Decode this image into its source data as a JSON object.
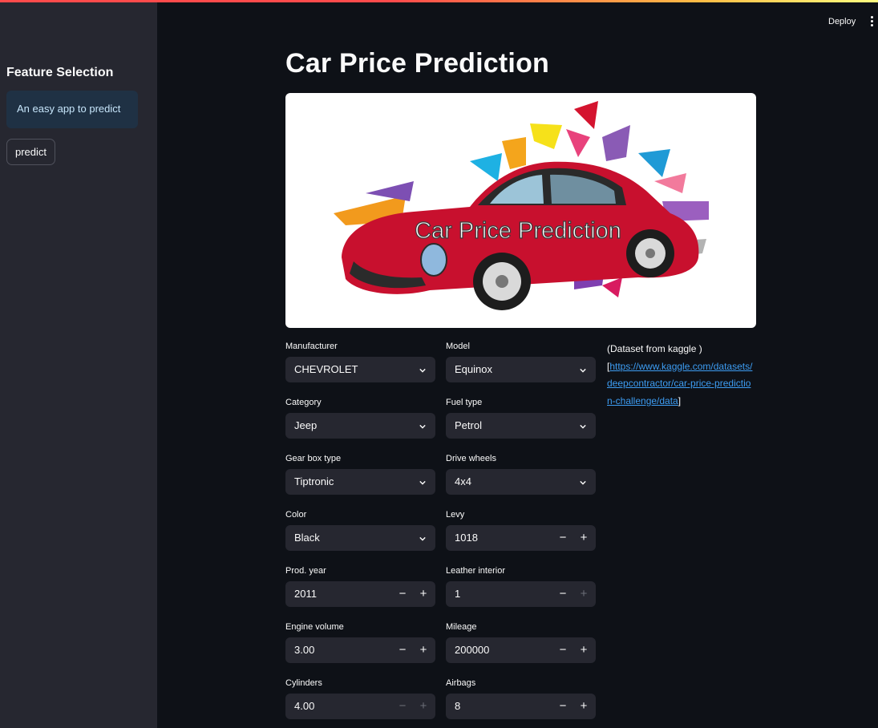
{
  "app": {
    "deploy_label": "Deploy",
    "menu_icon": "vertical-dots-icon"
  },
  "sidebar": {
    "title": "Feature Selection",
    "info_text": "An easy app to predict",
    "predict_label": "predict"
  },
  "main": {
    "title": "Car Price Prediction",
    "banner_text": "Car Price Prediction",
    "dataset_prefix": "(Dataset from kaggle )",
    "dataset_bracket_open": "[",
    "dataset_link": "https://www.kaggle.com/datasets/deepcontractor/car-price-prediction-challenge/data",
    "dataset_bracket_close": "]"
  },
  "fields": {
    "manufacturer": {
      "label": "Manufacturer",
      "value": "CHEVROLET"
    },
    "model": {
      "label": "Model",
      "value": "Equinox"
    },
    "category": {
      "label": "Category",
      "value": "Jeep"
    },
    "fuel_type": {
      "label": "Fuel type",
      "value": "Petrol"
    },
    "gear_box": {
      "label": "Gear box type",
      "value": "Tiptronic"
    },
    "drive_wheels": {
      "label": "Drive wheels",
      "value": "4x4"
    },
    "color": {
      "label": "Color",
      "value": "Black"
    },
    "levy": {
      "label": "Levy",
      "value": "1018"
    },
    "prod_year": {
      "label": "Prod. year",
      "value": "2011"
    },
    "leather_interior": {
      "label": "Leather interior",
      "value": "1"
    },
    "engine_volume": {
      "label": "Engine volume",
      "value": "3.00"
    },
    "mileage": {
      "label": "Mileage",
      "value": "200000"
    },
    "cylinders": {
      "label": "Cylinders",
      "value": "4.00"
    },
    "airbags": {
      "label": "Airbags",
      "value": "8"
    }
  },
  "stepper": {
    "minus": "−",
    "plus": "+"
  },
  "colors": {
    "background": "#0e1117",
    "sidebar": "#262730",
    "input": "#262730",
    "info": "#1f3144",
    "link": "#3d9df3",
    "car_red": "#c8102e"
  }
}
